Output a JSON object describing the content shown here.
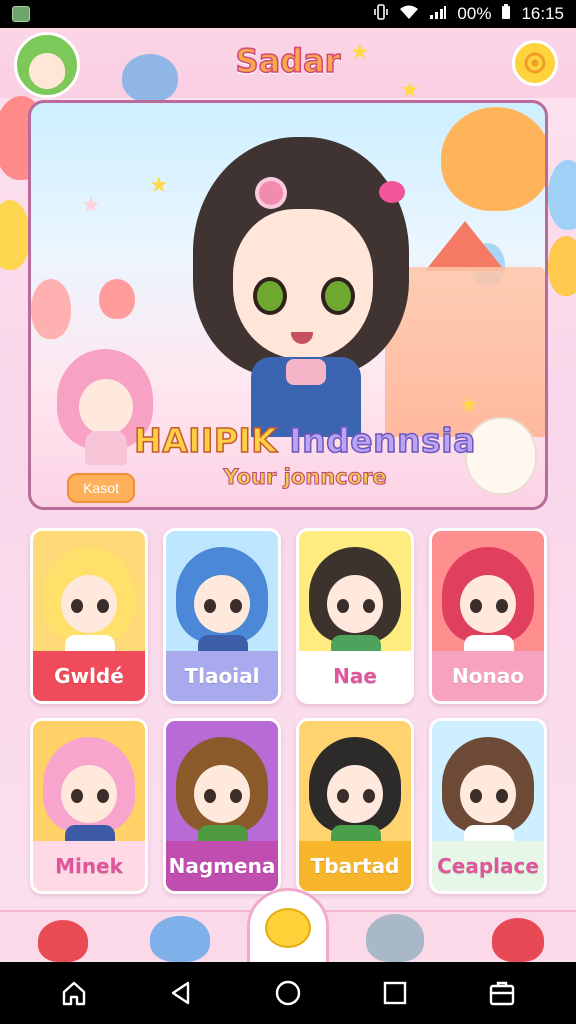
{
  "status_bar": {
    "time": "16:15",
    "battery_text": "00%",
    "icons": [
      "vibrate-icon",
      "wifi-icon",
      "signal-icon",
      "battery-icon"
    ]
  },
  "header": {
    "title": "Sadar",
    "settings_icon": "settings-icon"
  },
  "hero": {
    "title_part1": "HAIIPIK",
    "title_part2": "Indennsia",
    "subtitle": "Your jonncore",
    "button_label": "Kasot"
  },
  "cards": [
    {
      "name": "Gwldé",
      "label_color": "#f04b5a",
      "bg": "#ffd978",
      "hair": "#ffe06a",
      "outfit": "#ffffff"
    },
    {
      "name": "Tlaoial",
      "label_color": "#a9a9ee",
      "bg": "#bfe6ff",
      "hair": "#4b88d8",
      "outfit": "#3d5ea8"
    },
    {
      "name": "Nae",
      "label_color": "#ffffff",
      "bg": "#ffec80",
      "hair": "#3b332c",
      "outfit": "#4ea35c"
    },
    {
      "name": "Nonao",
      "label_color": "#f7a2bf",
      "bg": "#ff8f8f",
      "hair": "#e0405e",
      "outfit": "#ffffff"
    },
    {
      "name": "Minek",
      "label_color": "#ffd9e6",
      "bg": "#ffd166",
      "hair": "#f7a5cc",
      "outfit": "#3c5aa6"
    },
    {
      "name": "Nagmena",
      "label_color": "#c04db0",
      "bg": "#b86ad6",
      "hair": "#8a5a2b",
      "outfit": "#4f9a3e"
    },
    {
      "name": "Tbartad",
      "label_color": "#f7b52c",
      "bg": "#ffd470",
      "hair": "#2d2a2a",
      "outfit": "#4aa04a"
    },
    {
      "name": "Ceaplace",
      "label_color": "#e6f7e8",
      "bg": "#cdefff",
      "hair": "#6d4a35",
      "outfit": "#ffffff"
    }
  ],
  "nav": {
    "home_icon": "home-icon",
    "back_icon": "back-icon",
    "circle_icon": "home-circle-icon",
    "recents_icon": "recents-icon",
    "apps_icon": "apps-icon"
  },
  "colors": {
    "accent_pink": "#f9cfe3",
    "title_orange": "#f9a84c",
    "settings_yellow": "#ffd33b"
  }
}
